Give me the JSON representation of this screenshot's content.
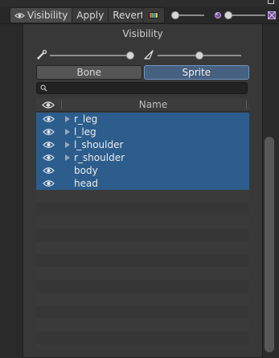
{
  "toolbar": {
    "visibility_label": "Visibility",
    "apply_label": "Apply",
    "revert_label": "Revert",
    "palette_colors": [
      "#e5533d",
      "#41b35b",
      "#3b7fe0",
      "#e8c93a"
    ]
  },
  "panel": {
    "title": "Visibility",
    "segments": {
      "bone_label": "Bone",
      "sprite_label": "Sprite",
      "active": "Sprite"
    },
    "search": {
      "value": "",
      "placeholder": ""
    },
    "table": {
      "header": {
        "name_label": "Name"
      },
      "rows": [
        {
          "label": "r_leg",
          "expandable": true,
          "selected": true
        },
        {
          "label": "l_leg",
          "expandable": true,
          "selected": true
        },
        {
          "label": "l_shoulder",
          "expandable": true,
          "selected": true
        },
        {
          "label": "r_shoulder",
          "expandable": true,
          "selected": true
        },
        {
          "label": "body",
          "expandable": false,
          "selected": true
        },
        {
          "label": "head",
          "expandable": false,
          "selected": true
        }
      ]
    }
  },
  "colors": {
    "selection": "#2c5d8c",
    "active_segment": "#46607f"
  }
}
